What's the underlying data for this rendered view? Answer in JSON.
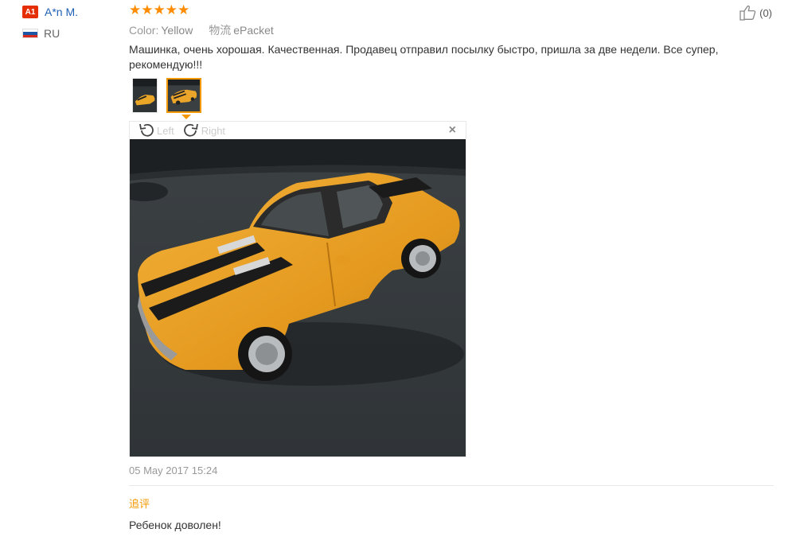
{
  "user": {
    "badge": "A1",
    "name": "A*n M.",
    "country": "RU",
    "flag_colors": [
      "#ffffff",
      "#1c57a5",
      "#d52b1e"
    ]
  },
  "review": {
    "rating": 5,
    "rating_max": 5,
    "star_color": "#ff8c00",
    "likes": "(0)",
    "color_label": "Color:",
    "color_value": "Yellow",
    "shipping_label": "物流",
    "shipping_value": "ePacket",
    "text": "Машинка, очень хорошая. Качественная. Продавец отправил посылку быстро, пришла за две недели. Все супер, рекомендую!!!",
    "date": "05 May 2017 15:24"
  },
  "gallery": {
    "thumbnail_count": 2,
    "active_index": 1,
    "rotate_left_label": "Left",
    "rotate_right_label": "Right",
    "close_symbol": "×"
  },
  "followup": {
    "label": "追评",
    "text": "Ребенок доволен!"
  },
  "colors": {
    "accent": "#f39800",
    "link": "#1f60b5",
    "badge": "#e62e04"
  }
}
